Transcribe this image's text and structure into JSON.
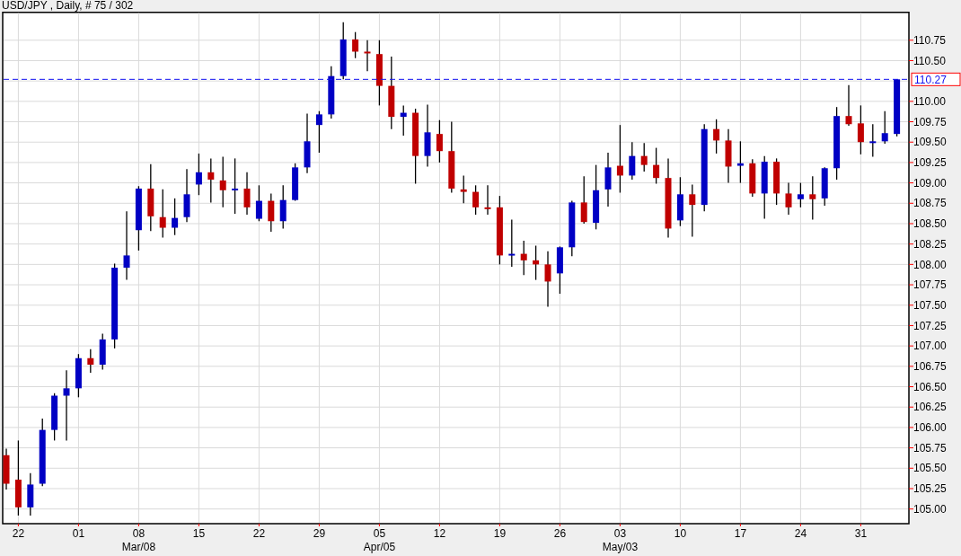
{
  "chart": {
    "chart_data": {
      "type": "candlestick",
      "title": "USD/JPY , Daily, # 75 / 302",
      "grid": true,
      "ylim": [
        104.82,
        111.1
      ],
      "categories": [
        null,
        "22",
        null,
        null,
        null,
        null,
        "01",
        null,
        null,
        null,
        null,
        "08\nMar/08",
        null,
        null,
        null,
        null,
        "15",
        null,
        null,
        null,
        null,
        "22",
        null,
        null,
        null,
        null,
        "29",
        null,
        null,
        null,
        null,
        "05\nApr/05",
        null,
        null,
        null,
        null,
        "12",
        null,
        null,
        null,
        null,
        "19",
        null,
        null,
        null,
        null,
        "26",
        null,
        null,
        null,
        null,
        "03\nMay/03",
        null,
        null,
        null,
        null,
        "10",
        null,
        null,
        null,
        null,
        "17",
        null,
        null,
        null,
        null,
        "24",
        null,
        null,
        null,
        null,
        "31",
        null,
        null,
        null
      ],
      "yticks": [
        {
          "value": 105,
          "label": "105.00"
        },
        {
          "value": 105.25,
          "label": "105.25"
        },
        {
          "value": 105.5,
          "label": "105.50"
        },
        {
          "value": 105.75,
          "label": "105.75"
        },
        {
          "value": 106,
          "label": "106.00"
        },
        {
          "value": 106.25,
          "label": "106.25"
        },
        {
          "value": 106.5,
          "label": "106.50"
        },
        {
          "value": 106.75,
          "label": "106.75"
        },
        {
          "value": 107,
          "label": "107.00"
        },
        {
          "value": 107.25,
          "label": "107.25"
        },
        {
          "value": 107.5,
          "label": "107.50"
        },
        {
          "value": 107.75,
          "label": "107.75"
        },
        {
          "value": 108,
          "label": "108.00"
        },
        {
          "value": 108.25,
          "label": "108.25"
        },
        {
          "value": 108.5,
          "label": "108.50"
        },
        {
          "value": 108.75,
          "label": "108.75"
        },
        {
          "value": 109,
          "label": "109.00"
        },
        {
          "value": 109.25,
          "label": "109.25"
        },
        {
          "value": 109.5,
          "label": "109.50"
        },
        {
          "value": 109.75,
          "label": "109.75"
        },
        {
          "value": 110,
          "label": "110.00"
        },
        {
          "value": 110.5,
          "label": "110.50"
        },
        {
          "value": 110.75,
          "label": "110.75"
        }
      ],
      "ohlc": [
        [
          105.66,
          105.74,
          105.24,
          105.31
        ],
        [
          105.36,
          105.84,
          104.92,
          105.02
        ],
        [
          105.02,
          105.44,
          104.92,
          105.3
        ],
        [
          105.31,
          106.11,
          105.28,
          105.97
        ],
        [
          105.97,
          106.42,
          105.84,
          106.39
        ],
        [
          106.39,
          106.7,
          105.84,
          106.48
        ],
        [
          106.48,
          106.9,
          106.37,
          106.85
        ],
        [
          106.85,
          106.96,
          106.67,
          106.77
        ],
        [
          106.77,
          107.15,
          106.71,
          107.08
        ],
        [
          107.08,
          108.01,
          106.97,
          107.96
        ],
        [
          107.96,
          108.65,
          107.81,
          108.11
        ],
        [
          108.42,
          108.96,
          108.17,
          108.93
        ],
        [
          108.93,
          109.23,
          108.41,
          108.59
        ],
        [
          108.58,
          108.92,
          108.33,
          108.45
        ],
        [
          108.45,
          108.81,
          108.36,
          108.57
        ],
        [
          108.58,
          109.17,
          108.52,
          108.86
        ],
        [
          108.98,
          109.36,
          108.85,
          109.13
        ],
        [
          109.13,
          109.3,
          108.76,
          109.04
        ],
        [
          109.03,
          109.32,
          108.7,
          108.91
        ],
        [
          108.91,
          109.3,
          108.62,
          108.93
        ],
        [
          108.93,
          109.13,
          108.61,
          108.7
        ],
        [
          108.56,
          108.97,
          108.53,
          108.78
        ],
        [
          108.78,
          108.87,
          108.4,
          108.53
        ],
        [
          108.53,
          108.97,
          108.44,
          108.79
        ],
        [
          108.79,
          109.24,
          108.78,
          109.19
        ],
        [
          109.19,
          109.85,
          109.12,
          109.51
        ],
        [
          109.71,
          109.88,
          109.37,
          109.84
        ],
        [
          109.84,
          110.43,
          109.79,
          110.31
        ],
        [
          110.31,
          110.97,
          110.27,
          110.76
        ],
        [
          110.76,
          110.85,
          110.53,
          110.61
        ],
        [
          110.61,
          110.75,
          110.37,
          110.6
        ],
        [
          110.58,
          110.75,
          109.95,
          110.19
        ],
        [
          110.19,
          110.55,
          109.66,
          109.81
        ],
        [
          109.81,
          109.95,
          109.58,
          109.86
        ],
        [
          109.86,
          109.91,
          108.99,
          109.33
        ],
        [
          109.33,
          109.96,
          109.2,
          109.62
        ],
        [
          109.6,
          109.77,
          109.25,
          109.39
        ],
        [
          109.39,
          109.75,
          108.88,
          108.93
        ],
        [
          108.92,
          109.09,
          108.75,
          108.89
        ],
        [
          108.89,
          108.97,
          108.61,
          108.7
        ],
        [
          108.7,
          108.97,
          108.61,
          108.69
        ],
        [
          108.7,
          108.84,
          108.0,
          108.11
        ],
        [
          108.11,
          108.55,
          107.97,
          108.13
        ],
        [
          108.13,
          108.29,
          107.87,
          108.05
        ],
        [
          108.05,
          108.23,
          107.81,
          108.0
        ],
        [
          108.0,
          108.16,
          107.48,
          107.79
        ],
        [
          107.89,
          108.22,
          107.64,
          108.21
        ],
        [
          108.21,
          108.78,
          108.1,
          108.76
        ],
        [
          108.76,
          109.08,
          108.5,
          108.52
        ],
        [
          108.51,
          109.22,
          108.43,
          108.91
        ],
        [
          108.92,
          109.37,
          108.71,
          109.19
        ],
        [
          109.21,
          109.71,
          108.88,
          109.09
        ],
        [
          109.09,
          109.5,
          109.04,
          109.33
        ],
        [
          109.33,
          109.49,
          109.14,
          109.22
        ],
        [
          109.22,
          109.43,
          108.99,
          109.06
        ],
        [
          109.06,
          109.3,
          108.33,
          108.44
        ],
        [
          108.54,
          109.07,
          108.47,
          108.86
        ],
        [
          108.86,
          108.98,
          108.34,
          108.73
        ],
        [
          108.73,
          109.72,
          108.65,
          109.66
        ],
        [
          109.66,
          109.78,
          109.36,
          109.52
        ],
        [
          109.52,
          109.66,
          109.0,
          109.2
        ],
        [
          109.21,
          109.51,
          109.0,
          109.24
        ],
        [
          109.24,
          109.29,
          108.83,
          108.87
        ],
        [
          108.87,
          109.33,
          108.56,
          109.26
        ],
        [
          109.26,
          109.3,
          108.73,
          108.87
        ],
        [
          108.87,
          109.0,
          108.61,
          108.7
        ],
        [
          108.8,
          109.0,
          108.7,
          108.86
        ],
        [
          108.86,
          109.08,
          108.55,
          108.8
        ],
        [
          108.81,
          109.19,
          108.72,
          109.18
        ],
        [
          109.18,
          109.93,
          109.04,
          109.82
        ],
        [
          109.82,
          110.2,
          109.7,
          109.72
        ],
        [
          109.73,
          109.95,
          109.35,
          109.5
        ],
        [
          109.5,
          109.72,
          109.32,
          109.51
        ],
        [
          109.51,
          109.88,
          109.48,
          109.61
        ],
        [
          109.6,
          110.27,
          109.57,
          110.27
        ]
      ],
      "ref_lines": [
        {
          "axis": "y",
          "value": 110.27,
          "label": "110.27"
        }
      ]
    }
  }
}
